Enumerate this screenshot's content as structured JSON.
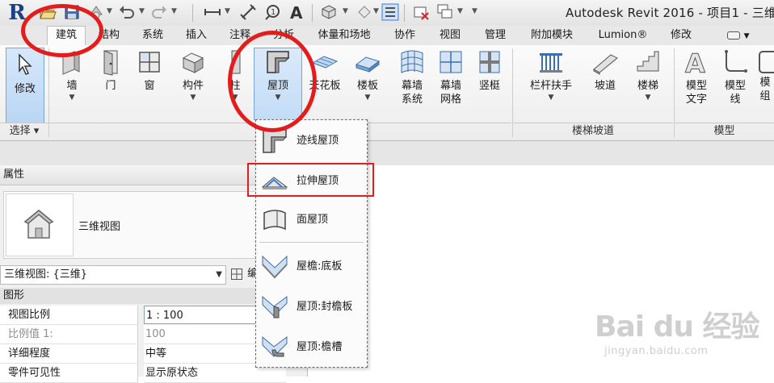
{
  "app": {
    "logo_letter": "R",
    "title": "Autodesk Revit 2016 -    项目1 - 三维"
  },
  "tabs": [
    {
      "label": "建筑",
      "active": true
    },
    {
      "label": "结构"
    },
    {
      "label": "系统"
    },
    {
      "label": "插入"
    },
    {
      "label": "注释"
    },
    {
      "label": "分析"
    },
    {
      "label": "体量和场地"
    },
    {
      "label": "协作"
    },
    {
      "label": "视图"
    },
    {
      "label": "管理"
    },
    {
      "label": "附加模块"
    },
    {
      "label": "Lumion®"
    },
    {
      "label": "修改"
    }
  ],
  "ribbon": {
    "modify": "修改",
    "wall": "墙",
    "door": "门",
    "window": "窗",
    "component": "构件",
    "column": "柱",
    "roof": "屋顶",
    "ceiling": "天花板",
    "floor": "楼板",
    "curtain_system": [
      "幕墙",
      "系统"
    ],
    "curtain_grid": [
      "幕墙",
      "网格"
    ],
    "mullion": "竖梃",
    "railing": "栏杆扶手",
    "ramp": "坡道",
    "stair": "楼梯",
    "model_text": [
      "模型",
      "文字"
    ],
    "model_line": [
      "模型",
      "线"
    ],
    "model_group": [
      "模",
      "组"
    ],
    "panels": {
      "select": "选择 ▾",
      "circulation": "楼梯坡道",
      "model": "模型"
    }
  },
  "roof_menu": [
    {
      "label": "迹线屋顶",
      "icon": "footprint-roof-icon"
    },
    {
      "label": "拉伸屋顶",
      "icon": "extrusion-roof-icon"
    },
    {
      "label": "面屋顶",
      "icon": "face-roof-icon"
    },
    {
      "label": "屋檐:底板",
      "icon": "roof-soffit-icon"
    },
    {
      "label": "屋顶:封檐板",
      "icon": "roof-fascia-icon"
    },
    {
      "label": "屋顶:檐槽",
      "icon": "roof-gutter-icon"
    }
  ],
  "properties": {
    "title": "属性",
    "type_name": "三维视图",
    "view_selector": "三维视图: {三维}",
    "edit_type": "编",
    "category": "图形",
    "rows": [
      {
        "key": "视图比例",
        "value": "1 : 100"
      },
      {
        "key": "比例值 1:",
        "value": "100",
        "dim": true
      },
      {
        "key": "详细程度",
        "value": "中等"
      },
      {
        "key": "零件可见性",
        "value": "显示原状态"
      }
    ]
  },
  "watermark": {
    "brand": "Bai du 经验",
    "url": "jingyan.baidu.com"
  },
  "colors": {
    "accent_blue": "#3a7bd5",
    "annotation_red": "#e31c1c"
  }
}
